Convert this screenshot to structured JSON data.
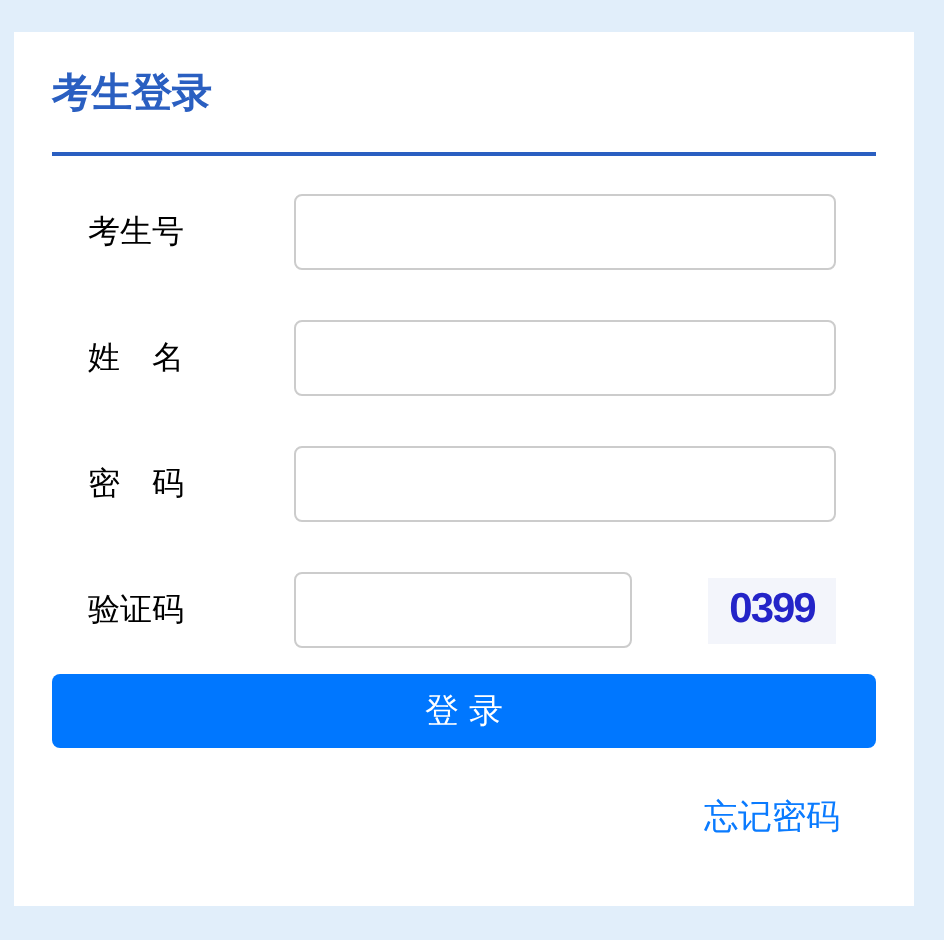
{
  "title": "考生登录",
  "fields": [
    {
      "label": "考生号",
      "kind": "text"
    },
    {
      "label": "姓　名",
      "kind": "text"
    },
    {
      "label": "密　码",
      "kind": "password"
    },
    {
      "label": "验证码",
      "kind": "captcha",
      "captcha": "0399"
    }
  ],
  "submit": "登 录",
  "forgot_link": "忘记密码"
}
